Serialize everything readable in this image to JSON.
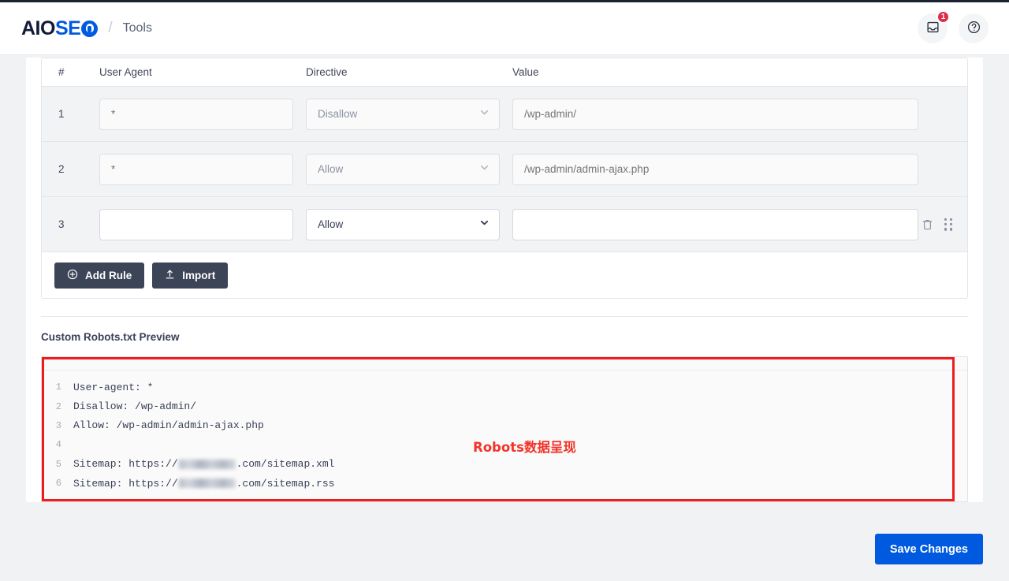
{
  "header": {
    "logo": {
      "part1": "AIO",
      "part2": "SE",
      "mark": "gear-circle-icon"
    },
    "separator": "/",
    "page_name": "Tools",
    "notifications": {
      "icon": "inbox-icon",
      "count": "1"
    },
    "help": {
      "icon": "help-circle-icon"
    }
  },
  "rules_table": {
    "columns": [
      "#",
      "User Agent",
      "Directive",
      "Value"
    ],
    "rows": [
      {
        "index": "1",
        "user_agent_value": "",
        "user_agent_placeholder": "*",
        "directive": "Disallow",
        "value": "",
        "value_placeholder": "/wp-admin/",
        "disabled": true,
        "has_actions": false
      },
      {
        "index": "2",
        "user_agent_value": "",
        "user_agent_placeholder": "*",
        "directive": "Allow",
        "value": "",
        "value_placeholder": "/wp-admin/admin-ajax.php",
        "disabled": true,
        "has_actions": false
      },
      {
        "index": "3",
        "user_agent_value": "",
        "user_agent_placeholder": "",
        "directive": "Allow",
        "value": "",
        "value_placeholder": "",
        "disabled": false,
        "has_actions": true
      }
    ],
    "directive_options": [
      "Allow",
      "Disallow"
    ],
    "row_actions": {
      "delete": "trash-icon",
      "drag": "drag-handle-icon"
    },
    "add_rule_label": "Add Rule",
    "add_rule_icon": "plus-circle-icon",
    "import_label": "Import",
    "import_icon": "upload-icon"
  },
  "preview": {
    "label": "Custom Robots.txt Preview",
    "lines": [
      {
        "n": "1",
        "pre": "User-agent: *",
        "blurred": false,
        "post": ""
      },
      {
        "n": "2",
        "pre": "Disallow: /wp-admin/",
        "blurred": false,
        "post": ""
      },
      {
        "n": "3",
        "pre": "Allow: /wp-admin/admin-ajax.php",
        "blurred": false,
        "post": ""
      },
      {
        "n": "4",
        "pre": "",
        "blurred": false,
        "post": ""
      },
      {
        "n": "5",
        "pre": "Sitemap: https://",
        "blurred": true,
        "post": ".com/sitemap.xml"
      },
      {
        "n": "6",
        "pre": "Sitemap: https://",
        "blurred": true,
        "post": ".com/sitemap.rss"
      }
    ],
    "annotation": "Robots数据呈现",
    "annotation_color": "#f2342a",
    "highlight_color": "#ef1c1c"
  },
  "footer": {
    "save_label": "Save Changes",
    "save_color": "#005ae0"
  }
}
